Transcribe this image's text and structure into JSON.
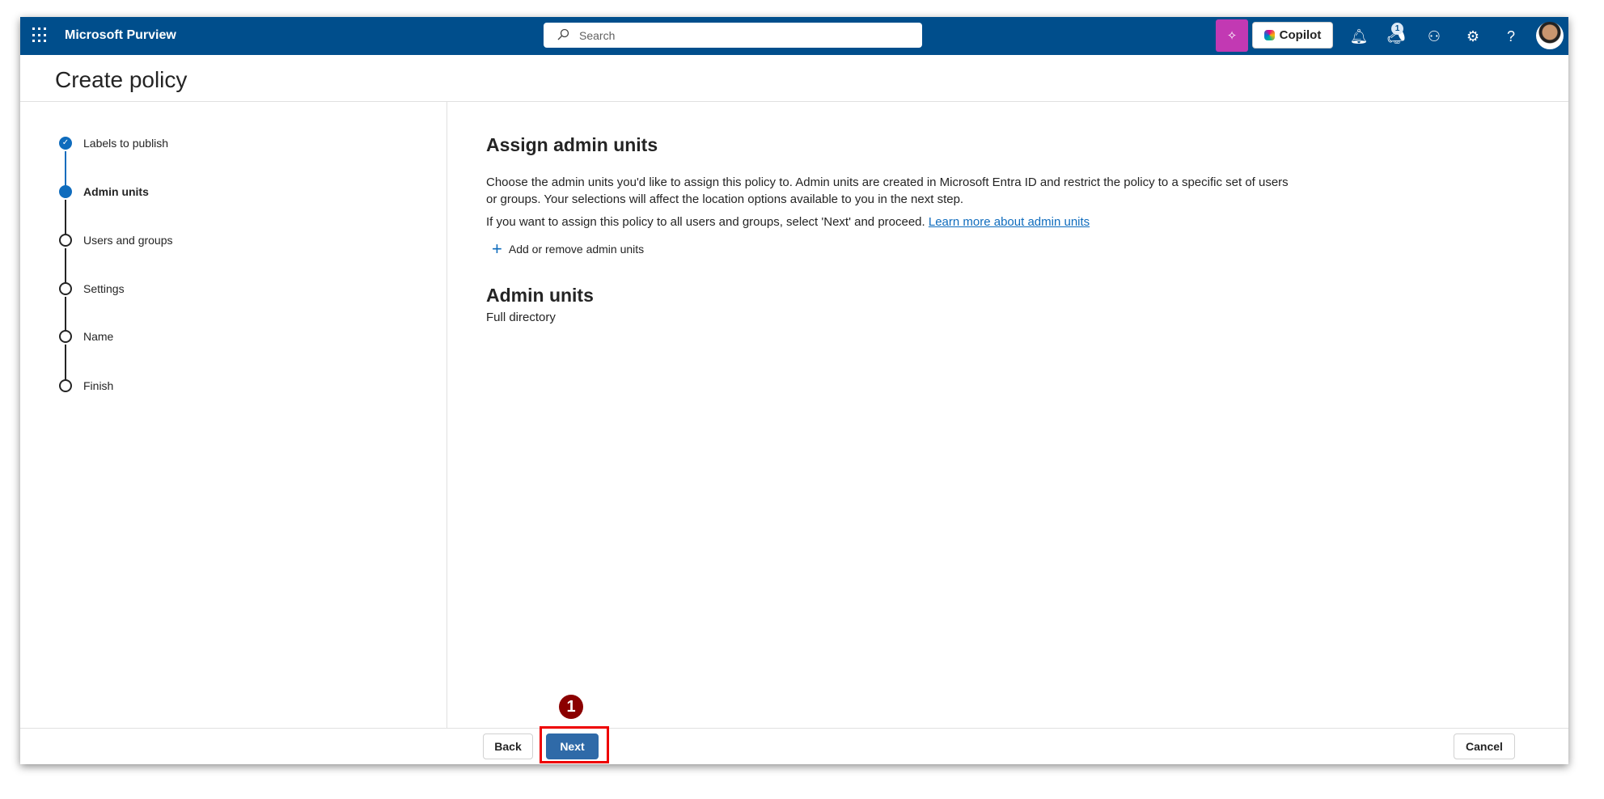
{
  "header": {
    "app_name": "Microsoft Purview",
    "search_placeholder": "Search",
    "copilot_label": "Copilot",
    "notification_count": "1"
  },
  "page": {
    "title": "Create policy"
  },
  "steps": [
    {
      "label": "Labels to publish",
      "state": "done"
    },
    {
      "label": "Admin units",
      "state": "current"
    },
    {
      "label": "Users and groups",
      "state": "todo"
    },
    {
      "label": "Settings",
      "state": "todo"
    },
    {
      "label": "Name",
      "state": "todo"
    },
    {
      "label": "Finish",
      "state": "todo"
    }
  ],
  "main": {
    "heading": "Assign admin units",
    "description": "Choose the admin units you'd like to assign this policy to. Admin units are created in Microsoft Entra ID and restrict the policy to a specific set of users or groups. Your selections will affect the location options available to you in the next step.",
    "hint": "If you want to assign this policy to all users and groups, select 'Next' and proceed.",
    "learn_more": "Learn more about admin units",
    "add_button": "Add or remove admin units",
    "section_heading": "Admin units",
    "section_value": "Full directory"
  },
  "footer": {
    "back": "Back",
    "next": "Next",
    "cancel": "Cancel"
  },
  "annotation": {
    "step_number": "1"
  },
  "colors": {
    "header": "#004e8c",
    "accent": "#0f6cbd",
    "primary_button": "#2f6aa8",
    "highlight": "#ee0000"
  }
}
